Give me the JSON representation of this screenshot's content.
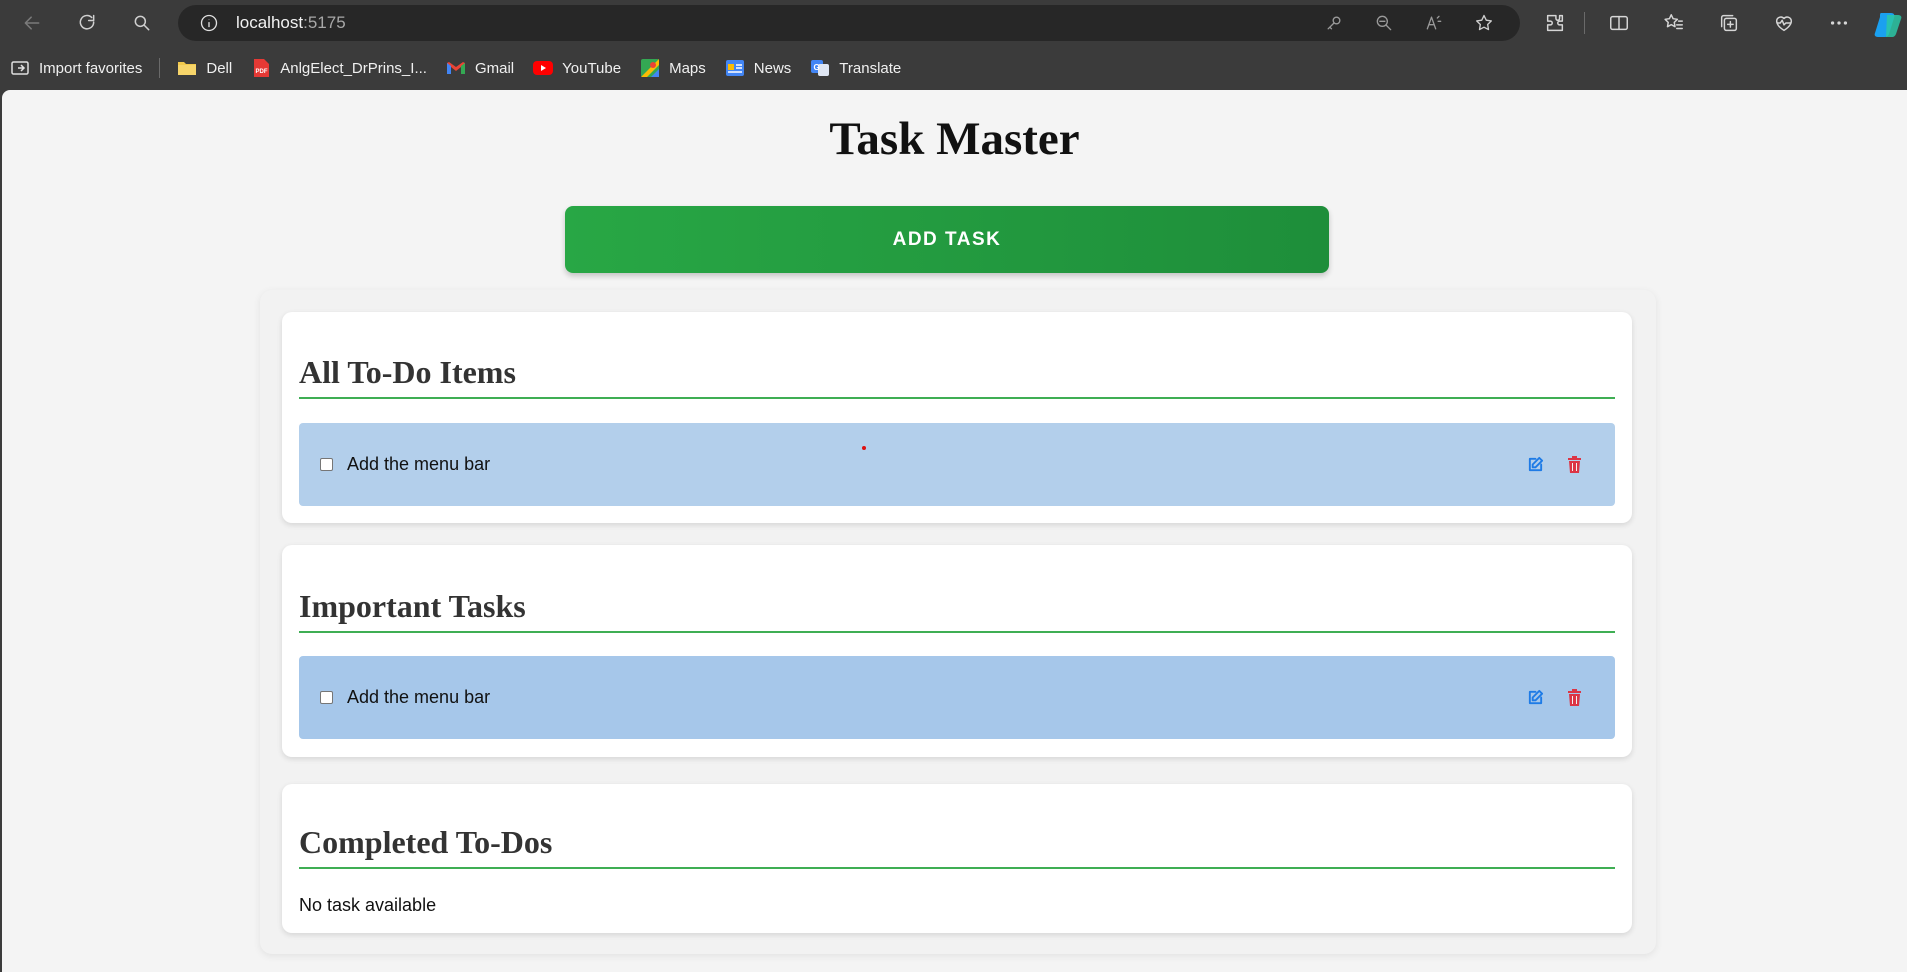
{
  "browser": {
    "url_host": "localhost",
    "url_port": ":5175",
    "bookmarks": [
      {
        "label": "Import favorites",
        "icon": "import-favorites-icon"
      },
      {
        "label": "Dell",
        "icon": "folder-icon"
      },
      {
        "label": "AnlgElect_DrPrins_I...",
        "icon": "pdf-icon"
      },
      {
        "label": "Gmail",
        "icon": "gmail-icon"
      },
      {
        "label": "YouTube",
        "icon": "youtube-icon"
      },
      {
        "label": "Maps",
        "icon": "maps-icon"
      },
      {
        "label": "News",
        "icon": "news-icon"
      },
      {
        "label": "Translate",
        "icon": "translate-icon"
      }
    ]
  },
  "app": {
    "title": "Task Master",
    "add_button": "ADD TASK",
    "sections": {
      "all": {
        "title": "All To-Do Items",
        "tasks": [
          {
            "text": "Add the menu bar",
            "completed": false
          }
        ]
      },
      "important": {
        "title": "Important Tasks",
        "tasks": [
          {
            "text": "Add the menu bar",
            "completed": false
          }
        ]
      },
      "completed": {
        "title": "Completed To-Dos",
        "empty_text": "No task available"
      }
    }
  },
  "colors": {
    "accent_green": "#28a745",
    "task_bg_all": "#b3cfeb",
    "task_bg_important": "#a6c7ea",
    "edit_blue": "#1e7be6",
    "delete_red": "#dc3545"
  }
}
